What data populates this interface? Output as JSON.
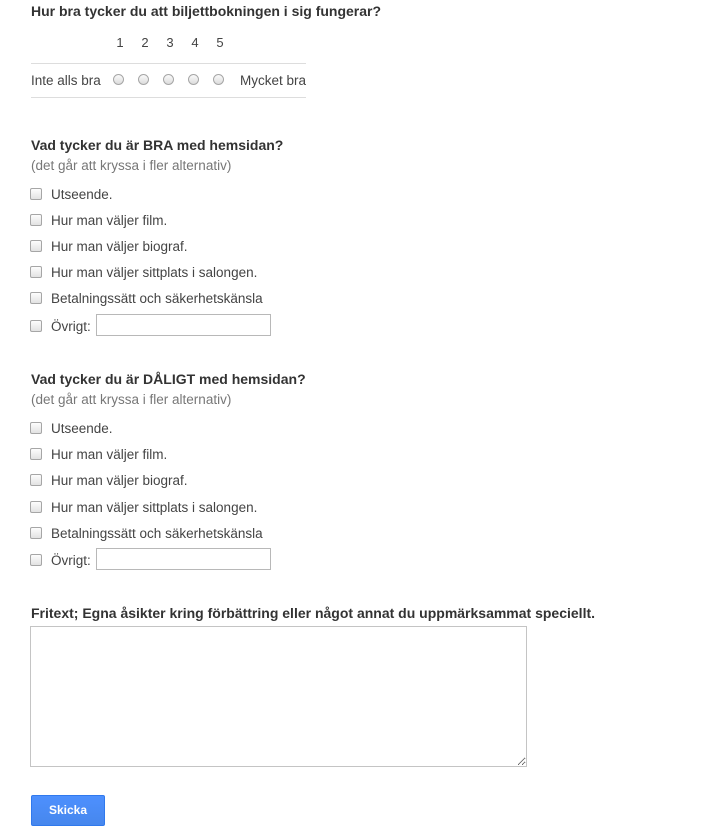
{
  "q1": {
    "title": "Hur bra tycker du att biljettbokningen i sig fungerar?",
    "scale_numbers": [
      "1",
      "2",
      "3",
      "4",
      "5"
    ],
    "low_label": "Inte alls bra",
    "high_label": "Mycket bra"
  },
  "q2": {
    "title": "Vad tycker du är BRA med hemsidan?",
    "help": "(det går att kryssa i fler alternativ)",
    "options": [
      "Utseende.",
      "Hur man väljer film.",
      "Hur man väljer biograf.",
      "Hur man väljer sittplats i salongen.",
      "Betalningssätt och säkerhetskänsla",
      "Övrigt:"
    ],
    "other_value": ""
  },
  "q3": {
    "title": "Vad tycker du är DÅLIGT med hemsidan?",
    "help": "(det går att kryssa i fler alternativ)",
    "options": [
      "Utseende.",
      "Hur man väljer film.",
      "Hur man väljer biograf.",
      "Hur man väljer sittplats i salongen.",
      "Betalningssätt och säkerhetskänsla",
      "Övrigt:"
    ],
    "other_value": ""
  },
  "q4": {
    "title": "Fritext; Egna åsikter kring förbättring eller något annat du uppmärksammat speciellt.",
    "value": ""
  },
  "submit": {
    "label": "Skicka"
  },
  "colors": {
    "accent": "#4d90fe",
    "title_text": "#333333",
    "help_text": "#777777"
  }
}
